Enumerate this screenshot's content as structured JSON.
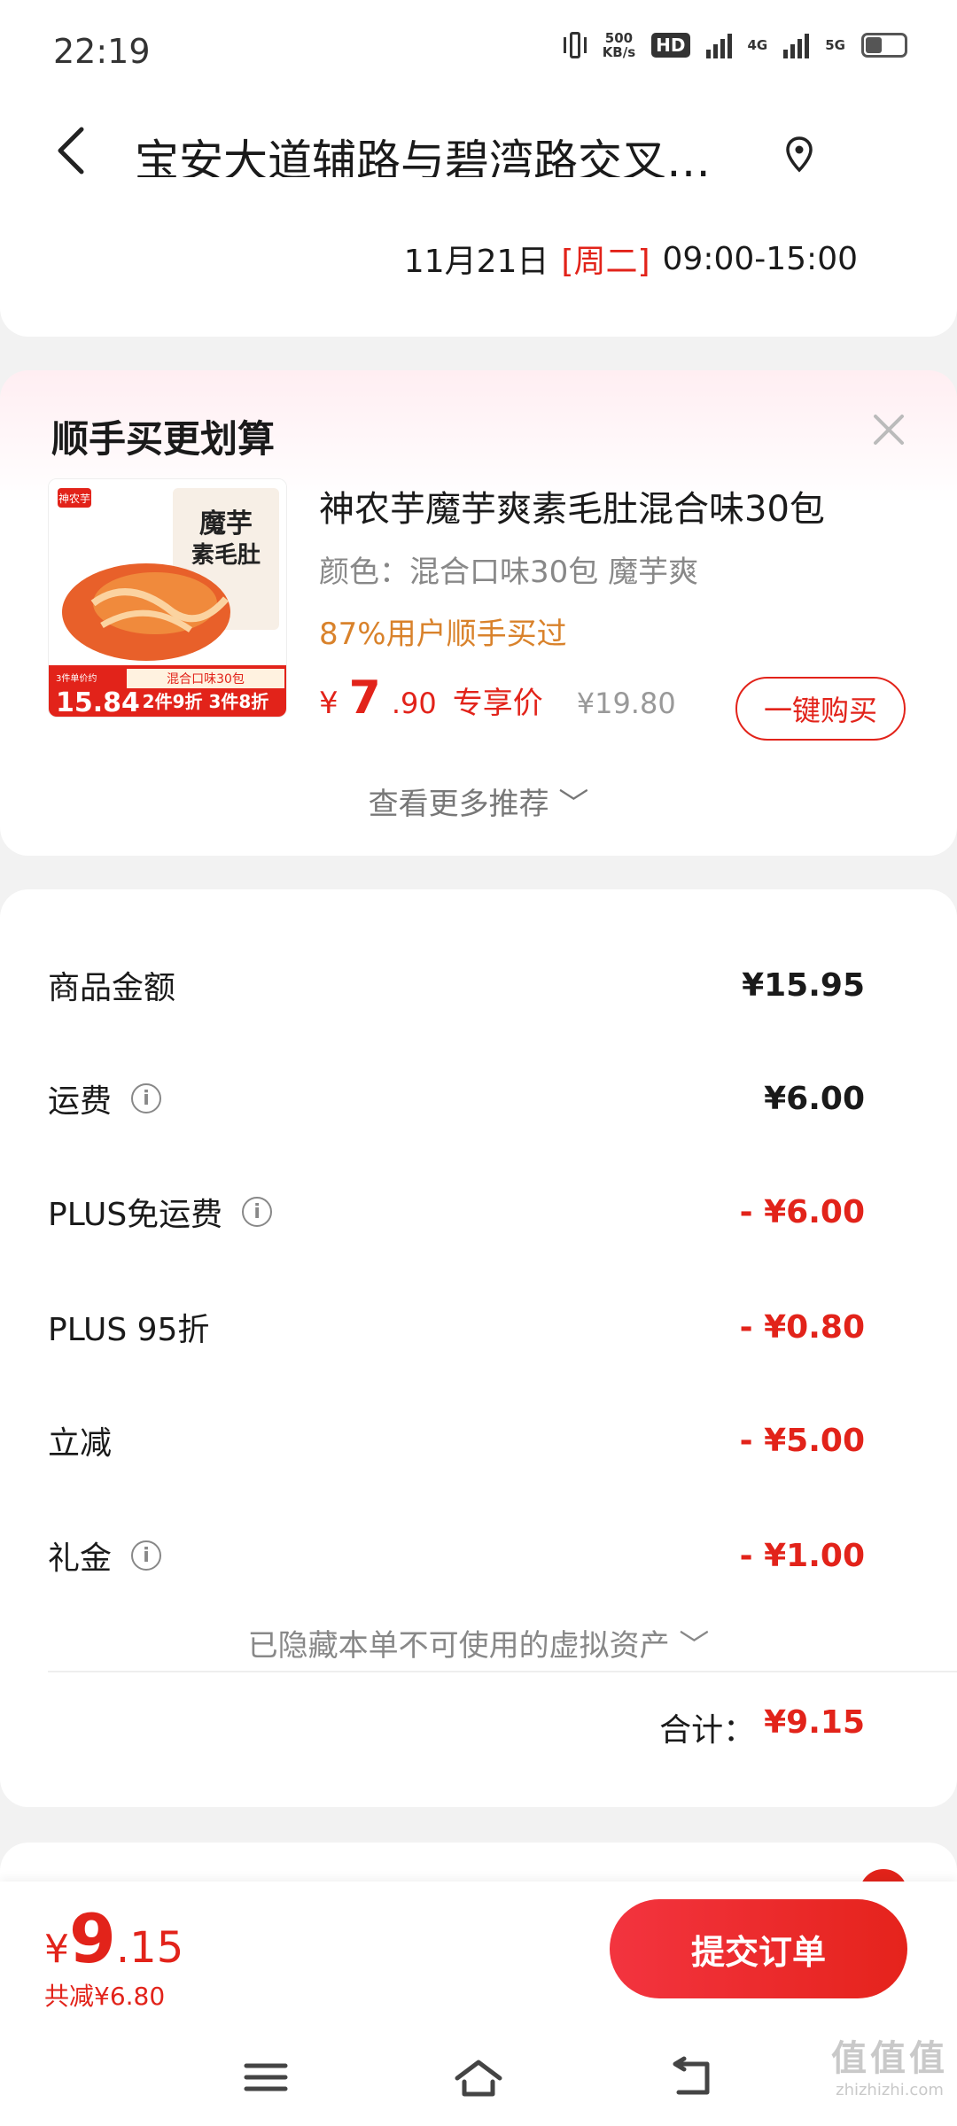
{
  "status_bar": {
    "time": "22:19",
    "net_speed_top": "500",
    "net_speed_bottom": "KB/s",
    "hd_label": "HD",
    "sim1_label": "4G",
    "sim2_label": "5G"
  },
  "header": {
    "title": "宝安大道辅路与碧湾路交叉…"
  },
  "delivery": {
    "date": "11月21日",
    "weekday": "[周二]",
    "time_range": "09:00-15:00"
  },
  "recommend": {
    "title": "顺手买更划算",
    "product": {
      "name": "神农芋魔芋爽素毛肚混合味30包",
      "spec": "颜色：混合口味30包  魔芋爽",
      "social_proof": "87%用户顺手买过",
      "price_symbol": "¥",
      "price_int": "7",
      "price_dec": ".90",
      "price_tag": "专享价",
      "original_price": "¥19.80",
      "buy_label": "一键购买",
      "image_brand": "神农芋",
      "image_title": "魔芋\n素毛肚",
      "image_flavor": "混合口味30包",
      "image_promo": "2件9折  3件8折",
      "image_price": "15.84",
      "image_price_label": "3件单价约"
    },
    "more_label": "查看更多推荐 ﹀"
  },
  "summary": {
    "rows": [
      {
        "label": "商品金额",
        "value": "¥15.95",
        "info": false,
        "neg": false
      },
      {
        "label": "运费",
        "value": "¥6.00",
        "info": true,
        "neg": false
      },
      {
        "label": "PLUS免运费",
        "value": "- ¥6.00",
        "info": true,
        "neg": true
      },
      {
        "label": "PLUS 95折",
        "value": "- ¥0.80",
        "info": false,
        "neg": true
      },
      {
        "label": "立减",
        "value": "- ¥5.00",
        "info": false,
        "neg": true
      },
      {
        "label": "礼金",
        "value": "- ¥1.00",
        "info": true,
        "neg": true
      }
    ],
    "hidden_note": "已隐藏本单不可使用的虚拟资产 ﹀",
    "total_label": "合计：",
    "total_value": "¥9.15"
  },
  "bottom_bar": {
    "price_symbol": "¥",
    "price_int": "9",
    "price_dec": ".15",
    "saved": "共减¥6.80",
    "submit_label": "提交订单"
  },
  "watermark": {
    "big": "值值值",
    "small": "zhizhizhi.com"
  },
  "colors": {
    "accent": "#e2231a",
    "orange": "#d9822b",
    "background": "#f2f2f2"
  }
}
